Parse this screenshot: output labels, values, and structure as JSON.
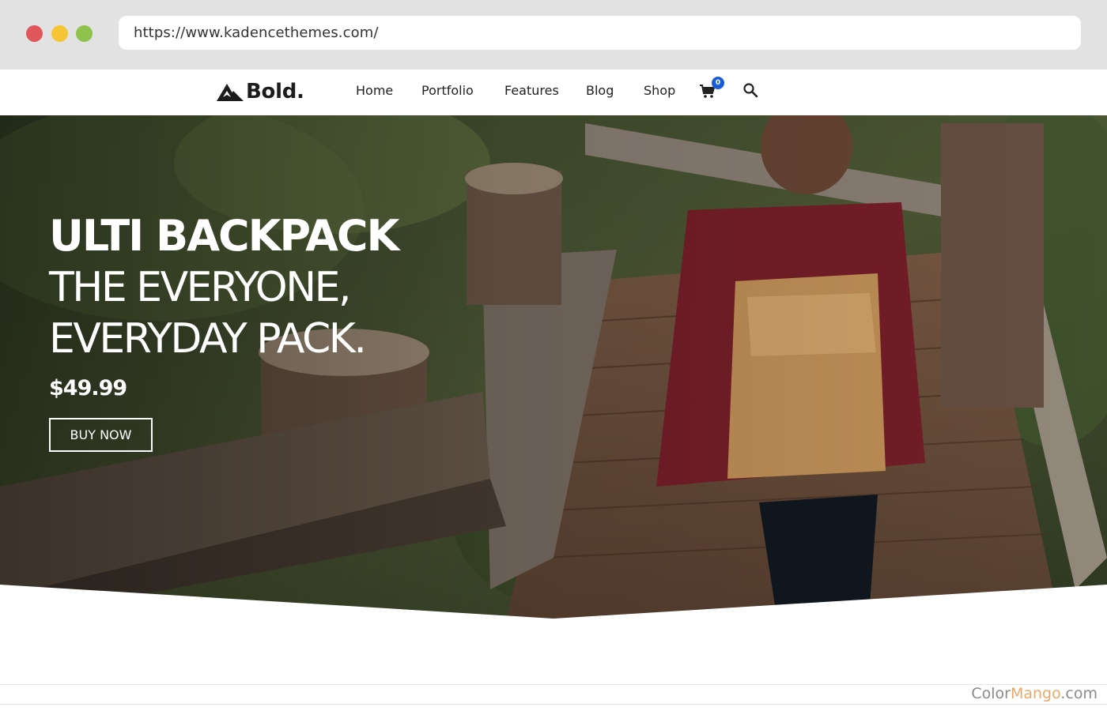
{
  "browser": {
    "url": "https://www.kadencethemes.com/"
  },
  "header": {
    "logo_text": "Bold.",
    "nav": [
      {
        "label": "Home"
      },
      {
        "label": "Portfolio"
      },
      {
        "label": "Features"
      },
      {
        "label": "Blog"
      },
      {
        "label": "Shop"
      }
    ],
    "cart_count": "0",
    "icons": [
      "mountain-logo-icon",
      "cart-icon",
      "search-icon"
    ]
  },
  "hero": {
    "title": "ULTI BACKPACK",
    "subtitle_line1": "THE EVERYONE,",
    "subtitle_line2": "EVERYDAY PACK.",
    "price": "$49.99",
    "button_label": "BUY NOW"
  },
  "watermark": {
    "part1": "Color",
    "part2": "Mango",
    "part3": ".com"
  },
  "colors": {
    "accent_badge": "#1a5bd6",
    "watermark_accent": "#e8a86a"
  }
}
